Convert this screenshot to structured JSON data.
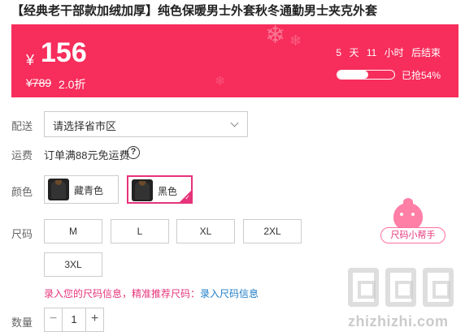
{
  "product": {
    "title": "【经典老干部款加绒加厚】纯色保暖男士外套秋冬通勤男士夹克外套"
  },
  "price_bar": {
    "currency": "¥",
    "price": "156",
    "original_price": "¥789",
    "discount": "2.0折",
    "countdown": {
      "days": "5",
      "days_unit": "天",
      "hours": "11",
      "hours_unit": "小时",
      "suffix": "后结束"
    },
    "sold_label": "已抢54%",
    "sold_fraction": 0.54,
    "background_color": "#f72d5b"
  },
  "delivery": {
    "label": "配送",
    "placeholder_value": "请选择省市区"
  },
  "shipping": {
    "label": "运费",
    "text": "订单满88元免运费"
  },
  "colors": {
    "label": "颜色",
    "options": [
      {
        "name": "藏青色",
        "selected": false
      },
      {
        "name": "黑色",
        "selected": true
      }
    ],
    "selected_border_color": "#e6337a"
  },
  "sizes": {
    "label": "尺码",
    "options": [
      "M",
      "L",
      "XL",
      "2XL",
      "3XL"
    ],
    "helper_label": "尺码小帮手",
    "info_prompt": "录入您的尺码信息，精准推荐尺码：",
    "info_link": "录入尺码信息"
  },
  "quantity": {
    "label": "数量",
    "value": "1",
    "minus": "−",
    "plus": "+"
  },
  "watermark": {
    "text": "zhizhizhi.com"
  }
}
